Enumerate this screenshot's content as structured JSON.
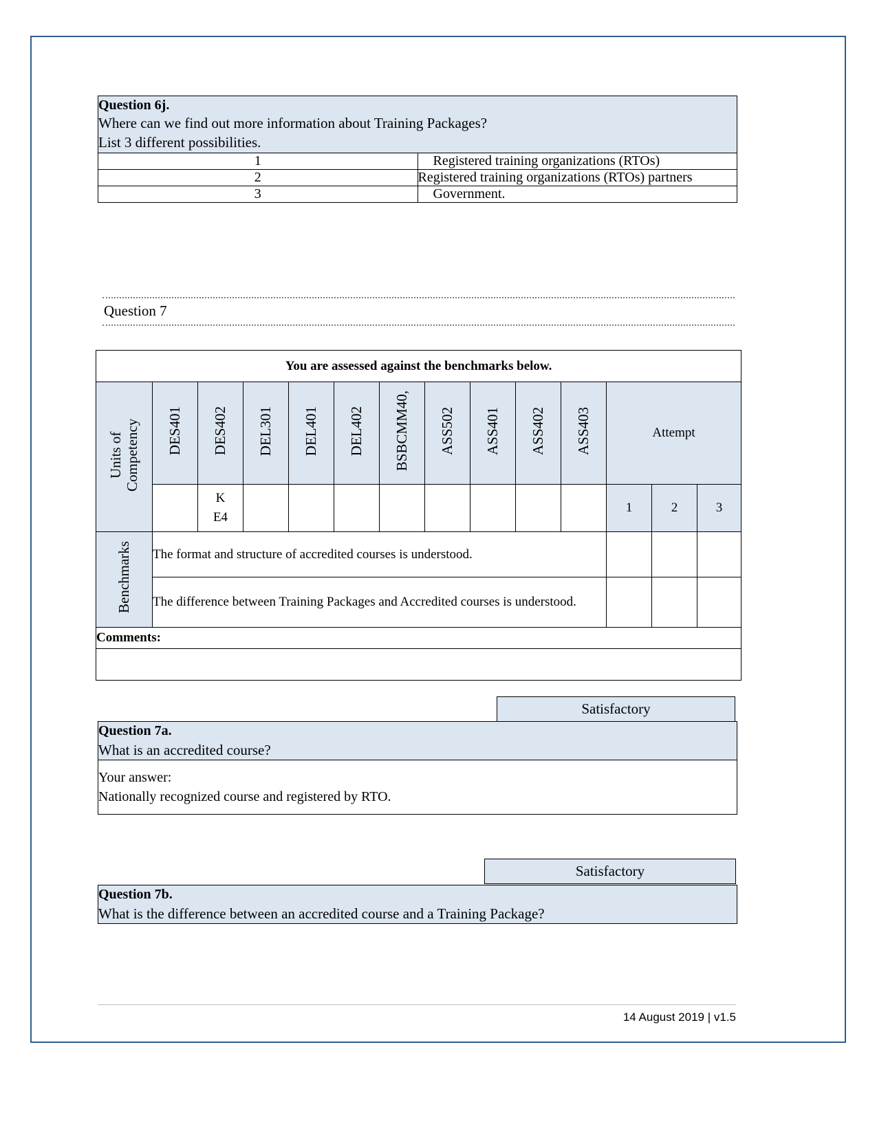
{
  "question6j": {
    "title": "Question 6j.",
    "prompt_line1": "Where can we find out more information about Training Packages?",
    "prompt_line2": "List 3 different possibilities.",
    "rows": [
      {
        "num": "1",
        "answer": "Registered training organizations (RTOs)"
      },
      {
        "num": "2",
        "answer": "Registered training organizations (RTOs) partners"
      },
      {
        "num": "3",
        "answer": "Government."
      }
    ]
  },
  "question7_heading": "Question 7",
  "benchmarks_table": {
    "title": "You are assessed against the benchmarks below.",
    "units_label": "Units of Competency",
    "unit_codes": [
      "DES401",
      "DES402",
      "DEL301",
      "DEL401",
      "DEL402",
      "BSBCMM40,",
      "ASS502",
      "ASS401",
      "ASS402",
      "ASS403"
    ],
    "attempt_label": "Attempt",
    "attempt_numbers": [
      "1",
      "2",
      "3"
    ],
    "code_row": [
      "",
      "K\nE4",
      "",
      "",
      "",
      "",
      "",
      "",
      "",
      ""
    ],
    "code_row_cell": "K E4",
    "benchmarks_label": "Benchmarks",
    "benchmarks": [
      "The format and structure of accredited courses is understood.",
      "The difference between Training Packages and Accredited courses is understood."
    ],
    "comments_label": "Comments:"
  },
  "question7a": {
    "status": "Satisfactory",
    "title": "Question 7a.",
    "prompt": "What is an accredited course?",
    "answer_label": "Your answer:",
    "answer_text": "Nationally recognized course and registered by RTO."
  },
  "question7b": {
    "status": "Satisfactory",
    "title": "Question 7b.",
    "prompt": "What is the difference between an accredited course and a Training Package?"
  },
  "footer": {
    "text": "14 August 2019 |  v1.5"
  },
  "colors": {
    "page_border": "#2e5f8a",
    "shade": "#dce6f1",
    "rule": "#7f7f7f"
  }
}
